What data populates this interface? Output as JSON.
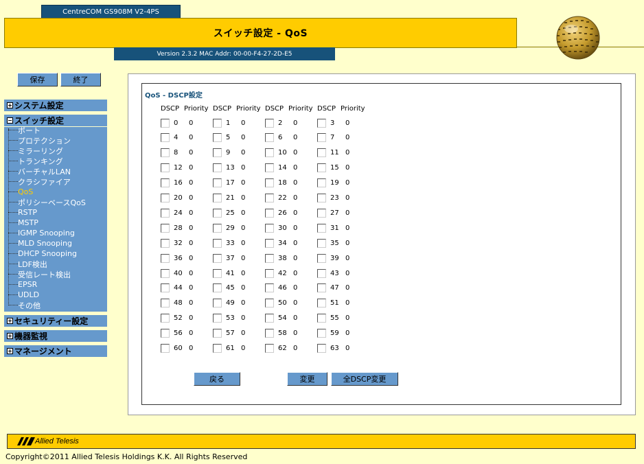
{
  "header": {
    "model": "CentreCOM GS908M V2-4PS",
    "title": "スイッチ設定 - QoS",
    "version": "Version 2.3.2 MAC Addr: 00-00-F4-27-2D-E5"
  },
  "top_buttons": {
    "save": "保存",
    "exit": "終了"
  },
  "menu": {
    "system": "システム設定",
    "switch": "スイッチ設定",
    "switch_items": [
      "ポート",
      "プロテクション",
      "ミラーリング",
      "トランキング",
      "バーチャルLAN",
      "クラシファイア",
      "QoS",
      "ポリシーベースQoS",
      "RSTP",
      "MSTP",
      "IGMP Snooping",
      "MLD Snooping",
      "DHCP Snooping",
      "LDF検出",
      "受信レート検出",
      "EPSR",
      "UDLD",
      "その他"
    ],
    "active_item": "QoS",
    "security": "セキュリティー設定",
    "monitor": "機器監視",
    "management": "マネージメント"
  },
  "content": {
    "section_title": "QoS - DSCP設定",
    "col_dscp": "DSCP",
    "col_priority": "Priority",
    "rows": [
      [
        [
          "0",
          "0"
        ],
        [
          "1",
          "0"
        ],
        [
          "2",
          "0"
        ],
        [
          "3",
          "0"
        ]
      ],
      [
        [
          "4",
          "0"
        ],
        [
          "5",
          "0"
        ],
        [
          "6",
          "0"
        ],
        [
          "7",
          "0"
        ]
      ],
      [
        [
          "8",
          "0"
        ],
        [
          "9",
          "0"
        ],
        [
          "10",
          "0"
        ],
        [
          "11",
          "0"
        ]
      ],
      [
        [
          "12",
          "0"
        ],
        [
          "13",
          "0"
        ],
        [
          "14",
          "0"
        ],
        [
          "15",
          "0"
        ]
      ],
      [
        [
          "16",
          "0"
        ],
        [
          "17",
          "0"
        ],
        [
          "18",
          "0"
        ],
        [
          "19",
          "0"
        ]
      ],
      [
        [
          "20",
          "0"
        ],
        [
          "21",
          "0"
        ],
        [
          "22",
          "0"
        ],
        [
          "23",
          "0"
        ]
      ],
      [
        [
          "24",
          "0"
        ],
        [
          "25",
          "0"
        ],
        [
          "26",
          "0"
        ],
        [
          "27",
          "0"
        ]
      ],
      [
        [
          "28",
          "0"
        ],
        [
          "29",
          "0"
        ],
        [
          "30",
          "0"
        ],
        [
          "31",
          "0"
        ]
      ],
      [
        [
          "32",
          "0"
        ],
        [
          "33",
          "0"
        ],
        [
          "34",
          "0"
        ],
        [
          "35",
          "0"
        ]
      ],
      [
        [
          "36",
          "0"
        ],
        [
          "37",
          "0"
        ],
        [
          "38",
          "0"
        ],
        [
          "39",
          "0"
        ]
      ],
      [
        [
          "40",
          "0"
        ],
        [
          "41",
          "0"
        ],
        [
          "42",
          "0"
        ],
        [
          "43",
          "0"
        ]
      ],
      [
        [
          "44",
          "0"
        ],
        [
          "45",
          "0"
        ],
        [
          "46",
          "0"
        ],
        [
          "47",
          "0"
        ]
      ],
      [
        [
          "48",
          "0"
        ],
        [
          "49",
          "0"
        ],
        [
          "50",
          "0"
        ],
        [
          "51",
          "0"
        ]
      ],
      [
        [
          "52",
          "0"
        ],
        [
          "53",
          "0"
        ],
        [
          "54",
          "0"
        ],
        [
          "55",
          "0"
        ]
      ],
      [
        [
          "56",
          "0"
        ],
        [
          "57",
          "0"
        ],
        [
          "58",
          "0"
        ],
        [
          "59",
          "0"
        ]
      ],
      [
        [
          "60",
          "0"
        ],
        [
          "61",
          "0"
        ],
        [
          "62",
          "0"
        ],
        [
          "63",
          "0"
        ]
      ]
    ],
    "back_button": "戻る",
    "change_button": "変更",
    "change_all_button": "全DSCP変更"
  },
  "footer": {
    "logo_text": "Allied Telesis",
    "copyright": "Copyright©2011 Allied Telesis Holdings K.K. All Rights Reserved"
  },
  "colors": {
    "background": "#ffffcc",
    "accent_yellow": "#ffcc00",
    "dark_blue": "#17527a",
    "menu_blue": "#6699cc"
  }
}
